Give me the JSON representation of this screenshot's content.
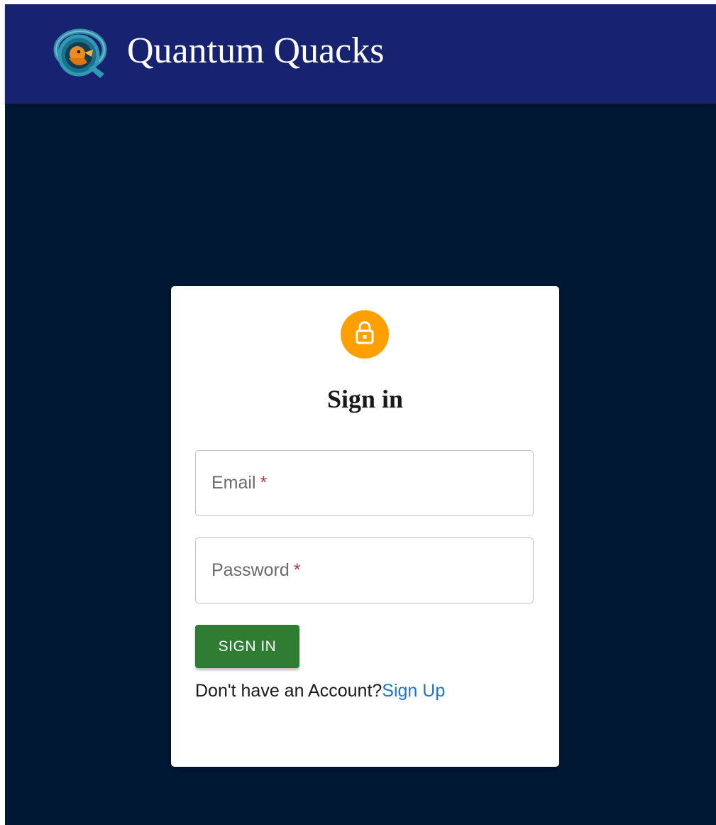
{
  "app": {
    "title": "Quantum Quacks",
    "logo_icon": "quantum-quacks-logo",
    "colors": {
      "appbar": "#172370",
      "background": "#001833",
      "lock_avatar": "#ffa000",
      "submit_button": "#2e7d32",
      "link": "#1976d2",
      "required_mark": "#d32f2f"
    }
  },
  "signin": {
    "icon": "lock-icon",
    "heading": "Sign in",
    "email": {
      "label": "Email",
      "required_mark": "*",
      "value": ""
    },
    "password": {
      "label": "Password",
      "required_mark": "*",
      "value": ""
    },
    "submit_label": "SIGN IN",
    "no_account_text": "Don't have an Account?",
    "signup_link_text": "Sign Up"
  }
}
